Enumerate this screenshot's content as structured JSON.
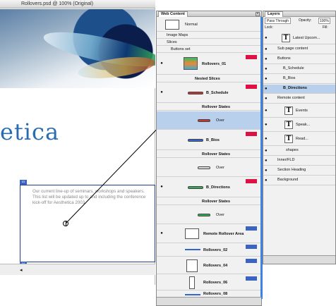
{
  "document": {
    "title": "Rollovers.psd @ 100% (Original)",
    "logo_text": "etica",
    "slice_text": "Our current line-up of seminars, workshops and speakers. This list will be updated up to and including the conference kick-off for Aesthetica 2003.",
    "slice_tag_top": "03",
    "slice_tag_bottom": "04"
  },
  "web_content": {
    "tab_label": "Web Content",
    "normal_label": "Normal",
    "image_maps_label": "Image Maps",
    "slices_label": "Slices",
    "buttons_set_label": "Buttons set",
    "rows": [
      {
        "label": "Rollovers_01"
      },
      {
        "label": "Nested Slices"
      },
      {
        "label": "B_Schedule"
      },
      {
        "label": "Rollover States"
      },
      {
        "label": "Over"
      },
      {
        "label": "B_Bios"
      },
      {
        "label": "Rollover States"
      },
      {
        "label": "Over"
      },
      {
        "label": "B_Directions"
      },
      {
        "label": "Rollover States"
      },
      {
        "label": "Over"
      },
      {
        "label": "Remote Rollover Area"
      },
      {
        "label": "Rollovers_02"
      },
      {
        "label": "Rollovers_04"
      },
      {
        "label": "Rollovers_06"
      },
      {
        "label": "Rollovers_08"
      },
      {
        "label": "Rollovers_08"
      }
    ]
  },
  "layers": {
    "tab_label": "Layers",
    "blend_mode": "Pass Through",
    "opacity_label": "Opacity:",
    "opacity_value": "100%",
    "lock_label": "Lock:",
    "fill_label": "Fill:",
    "rows": [
      {
        "label": "Latest Upcom...",
        "kind": "text"
      },
      {
        "label": "Sub page content",
        "kind": "folder"
      },
      {
        "label": "Buttons",
        "kind": "folder"
      },
      {
        "label": "B_Schedule",
        "kind": "folder"
      },
      {
        "label": "B_Bios",
        "kind": "folder"
      },
      {
        "label": "B_Directions",
        "kind": "folder"
      },
      {
        "label": "Remote content",
        "kind": "folder"
      },
      {
        "label": "Events",
        "kind": "text"
      },
      {
        "label": "Speak...",
        "kind": "text"
      },
      {
        "label": "Read...",
        "kind": "text"
      },
      {
        "label": "shapes",
        "kind": "folder"
      },
      {
        "label": "Inner/FLD",
        "kind": "folder"
      },
      {
        "label": "Section Heading",
        "kind": "folder"
      },
      {
        "label": "Background",
        "kind": "folder"
      }
    ]
  },
  "colors": {
    "accent": "#3e83e0",
    "tag_red": "#dd1144",
    "tag_blue": "#3a63c4",
    "selection": "#b8d0ec"
  }
}
